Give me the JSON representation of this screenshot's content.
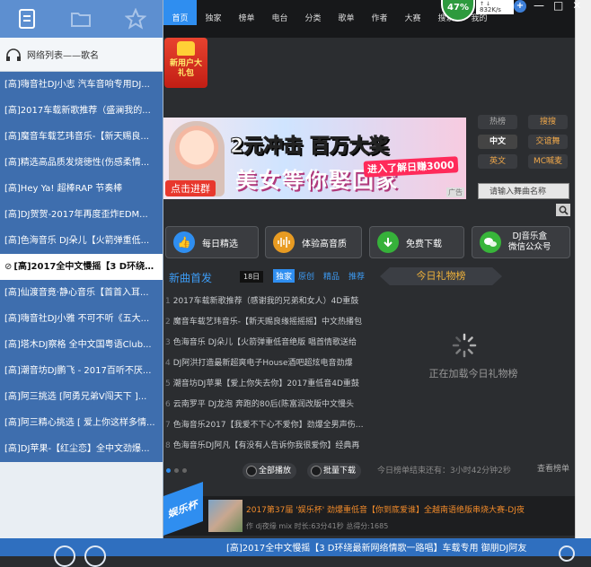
{
  "left_panel": {
    "icons": [
      "list-icon",
      "folder-icon",
      "star-icon"
    ],
    "header": "网络列表——歌名",
    "playlist": [
      {
        "label": "[高]嗨音社DJ小志 汽车音响专用DJ..."
      },
      {
        "label": "[高]2017车载新歌推荐（盛澜我的..."
      },
      {
        "label": "[高]魔音车载艺玮音乐-【新天赐良..."
      },
      {
        "label": "[高]精选高品质发烧徳性(伤感柔情..."
      },
      {
        "label": "[高]Hey Ya! 超棒RAP 节奏棒"
      },
      {
        "label": "[高]DJ贺贺-2017年再度歪炸EDM..."
      },
      {
        "label": "[高]色海音乐 DJ朵儿【火箭弹重低..."
      },
      {
        "label": "[高]2017全中文慢摇【3 D环绕最..."
      },
      {
        "label": "[高]仙渡音竟·静心音乐【首首入耳..."
      },
      {
        "label": "[高]嗨音社DJ小雅 不可不听《五大..."
      },
      {
        "label": "[高]塔木DJ察格 全中文国粤语Club..."
      },
      {
        "label": "[高]潮音坊DJ鹏飞 - 2017百听不厌..."
      },
      {
        "label": "[高]阿三挑选 [阿勇兄弟V闯天下 ]..."
      },
      {
        "label": "[高]阿三精心挑选 [ 爱上你这样多情..."
      },
      {
        "label": "[高]DJ苹果-【红尘恋】全中文劲爆..."
      }
    ],
    "active_index": 7
  },
  "top_right": {
    "percent": "47%",
    "speed": "832K/s",
    "window_buttons": [
      "—",
      "□",
      "✕"
    ]
  },
  "nav": {
    "items": [
      "首页",
      "独家",
      "榜单",
      "电台",
      "分类",
      "歌单",
      "作者",
      "大赛",
      "搜索",
      "我的"
    ],
    "active": 0
  },
  "promo": {
    "gift_text": "新用户大礼包"
  },
  "banner": {
    "line1_a": "2元冲击",
    "line1_b": "百万大奖",
    "line2": "美女等你娶回家",
    "badge": "进入了解日赚3000",
    "cta": "点击进群",
    "ad_tag": "广告"
  },
  "side_buttons": {
    "row1": [
      "热榜",
      "搜搜"
    ],
    "row2": [
      "中文",
      "交谊舞"
    ],
    "row3": [
      "英文",
      "MC喊麦"
    ]
  },
  "search": {
    "placeholder": "请输入舞曲名称"
  },
  "features": [
    {
      "label": "每日精选",
      "icon": "thumbs-up-icon"
    },
    {
      "label": "体验高音质",
      "icon": "waveform-icon"
    },
    {
      "label": "免费下载",
      "icon": "download-icon"
    },
    {
      "label": "DJ音乐盒\n微信公众号",
      "icon": "wechat-icon"
    }
  ],
  "new_songs": {
    "title": "新曲首发",
    "date": "18日",
    "tabs": [
      "独家",
      "原创",
      "精品",
      "推荐"
    ],
    "songs": [
      "2017车载新歌推荐（感谢我的兄弟和女人）4D重鼓",
      "魔音车载艺玮音乐-【新天赐良缘摇摇摇】中文热播包",
      "色海音乐 DJ朵儿【火箭弹重低音绝版 唱首情歌送给",
      "DJ阿洪打造最新超爽电子House酒吧超炫电音劲爆",
      "潮音坊DJ苹果【爱上你失去你】2017重低音4D重鼓",
      "云南罗平 DJ龙泡 奔跑的80后(陈富润改版中文慢头",
      "色海音乐2017【我爱不下心不爱你】劲爆全男声伤感嗨",
      "色海音乐DJ阿凡【有没有人告诉你我很爱你】经典再"
    ],
    "play_all": "全部播放",
    "batch_download": "批量下载"
  },
  "gift_rank": {
    "title": "今日礼物榜",
    "loading": "正在加载今日礼物榜",
    "countdown": "今日榜单结束还有：3小时42分钟2秒",
    "view_rank": "查看榜单"
  },
  "bottom_banner": {
    "tag": "娱乐杯",
    "title": "2017第37届 '娱乐杯' 劲爆重低音【你到底爱谁】全越南语绝版串烧大赛-DJ夜",
    "meta": "作 dj夜缘 mix   时长:63分41秒   总得分:1685"
  },
  "status_bar": {
    "now_playing": "[高]2017全中文慢摇【3 D环绕最新网络情歌一路唱】车载专用 御朋DJ阿友"
  }
}
